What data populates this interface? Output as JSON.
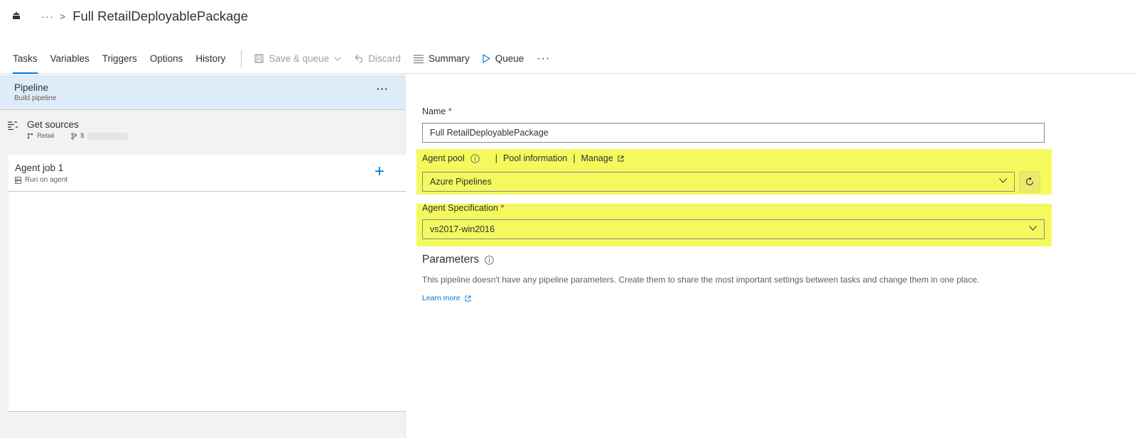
{
  "header": {
    "home_icon": "build-pipeline-icon",
    "breadcrumb_ellipsis": "···",
    "breadcrumb_separator": ">",
    "title": "Full RetailDeployablePackage"
  },
  "tabs": [
    {
      "label": "Tasks",
      "active": true
    },
    {
      "label": "Variables"
    },
    {
      "label": "Triggers"
    },
    {
      "label": "Options"
    },
    {
      "label": "History"
    }
  ],
  "toolbar": {
    "save_queue": "Save & queue",
    "discard": "Discard",
    "summary": "Summary",
    "queue": "Queue",
    "more": "···"
  },
  "pipeline": {
    "title": "Pipeline",
    "subtitle": "Build pipeline",
    "more": "···"
  },
  "sources": {
    "title": "Get sources",
    "repo": "Retail",
    "branch": "$"
  },
  "job": {
    "title": "Agent job 1",
    "subtitle": "Run on agent",
    "add": "+"
  },
  "form": {
    "name_label": "Name",
    "required_mark": "*",
    "name_value": "Full RetailDeployablePackage",
    "pool_label": "Agent pool",
    "pool_separator": "|",
    "pool_info_link": "Pool information",
    "manage_link": "Manage",
    "pool_value": "Azure Pipelines",
    "spec_label": "Agent Specification",
    "spec_value": "vs2017-win2016"
  },
  "parameters": {
    "title": "Parameters",
    "description": "This pipeline doesn't have any pipeline parameters. Create them to share the most important settings between tasks and change them in one place.",
    "learn_more": "Learn more"
  },
  "colors": {
    "accent": "#0078d4",
    "highlight": "#f4f95e",
    "selected_row": "#deecf9",
    "required": "#a4262c"
  }
}
